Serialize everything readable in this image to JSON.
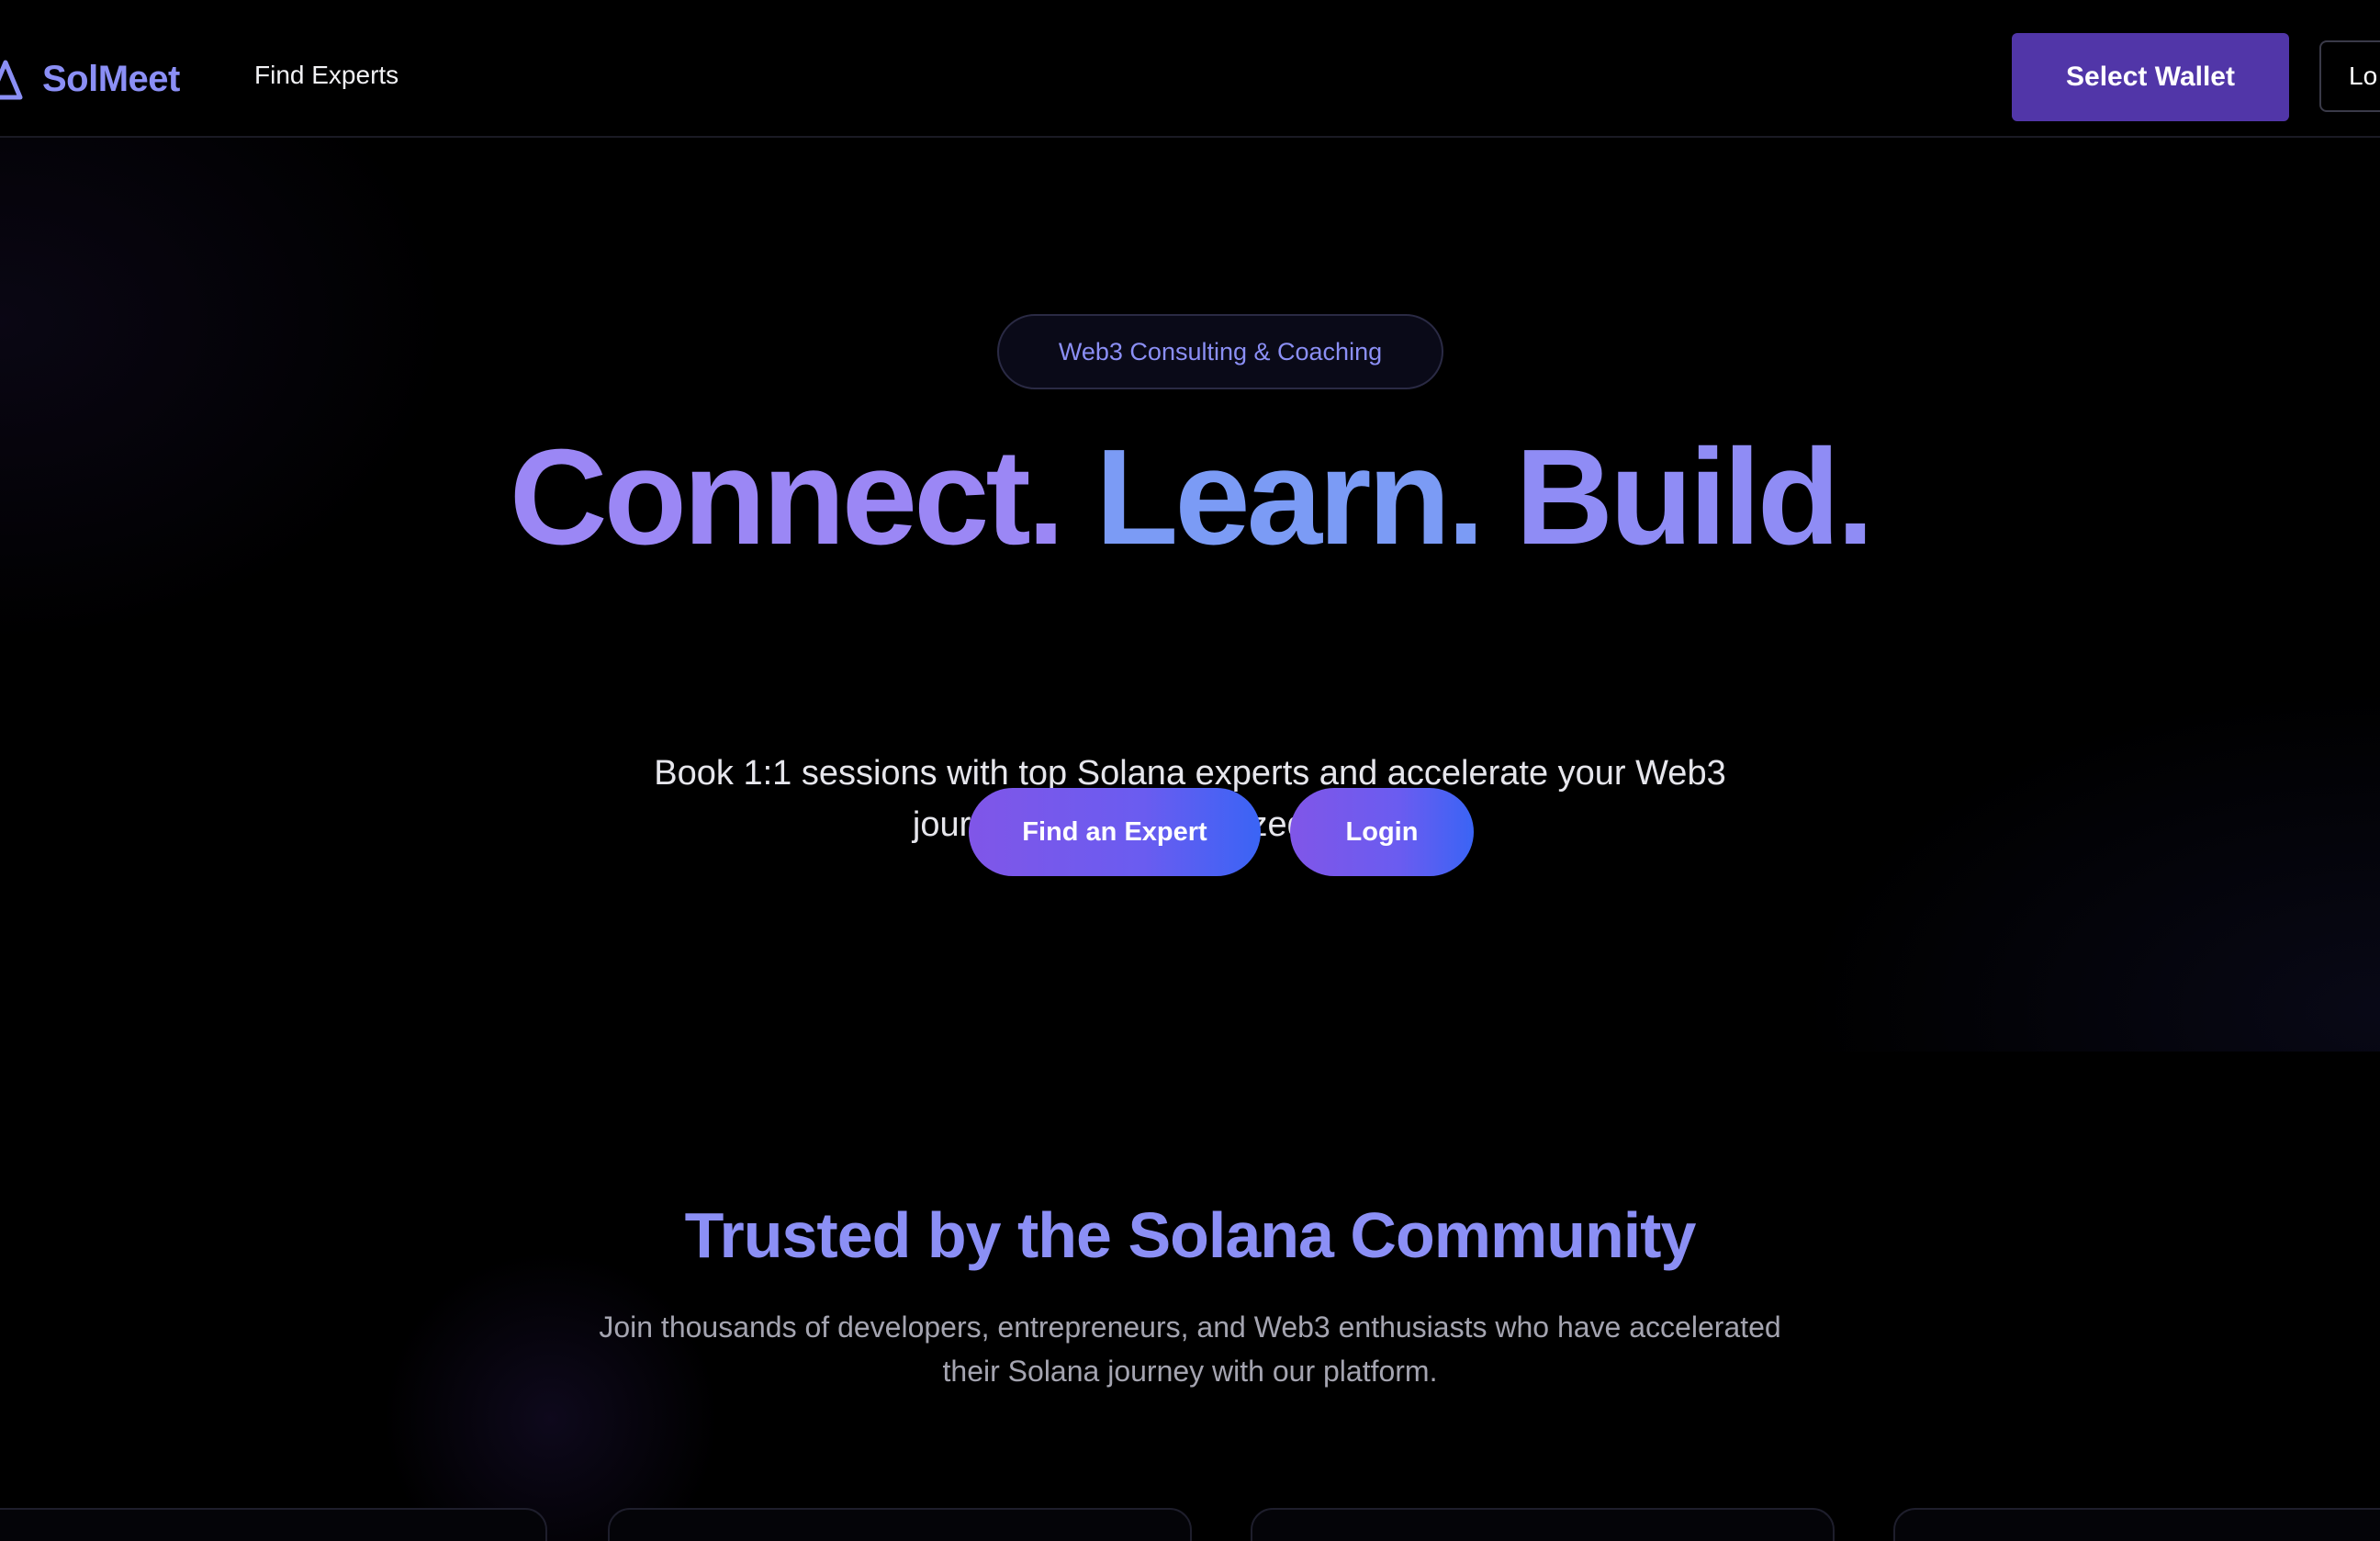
{
  "header": {
    "logo_text": "SolMeet",
    "logo_icon": "triangle-logo-icon",
    "nav_find_experts": "Find Experts",
    "select_wallet_label": "Select Wallet",
    "login_label": "Lo"
  },
  "hero": {
    "badge": "Web3 Consulting & Coaching",
    "title_part1": "Connect.",
    "title_part2": "Learn.",
    "title_part3": "Build.",
    "subtitle": "Book 1:1 sessions with top Solana experts and accelerate your Web3 journey with personalized guidance.",
    "find_expert_label": "Find an Expert",
    "login_label": "Login"
  },
  "community": {
    "title": "Trusted by the Solana Community",
    "description": "Join thousands of developers, entrepreneurs, and Web3 enthusiasts who have accelerated their Solana journey with our platform."
  },
  "colors": {
    "accent": "#8b8ff5",
    "wallet_button": "#5136a8",
    "gradient_start": "#8056e8",
    "gradient_end": "#3a64f5",
    "background": "#000000"
  }
}
